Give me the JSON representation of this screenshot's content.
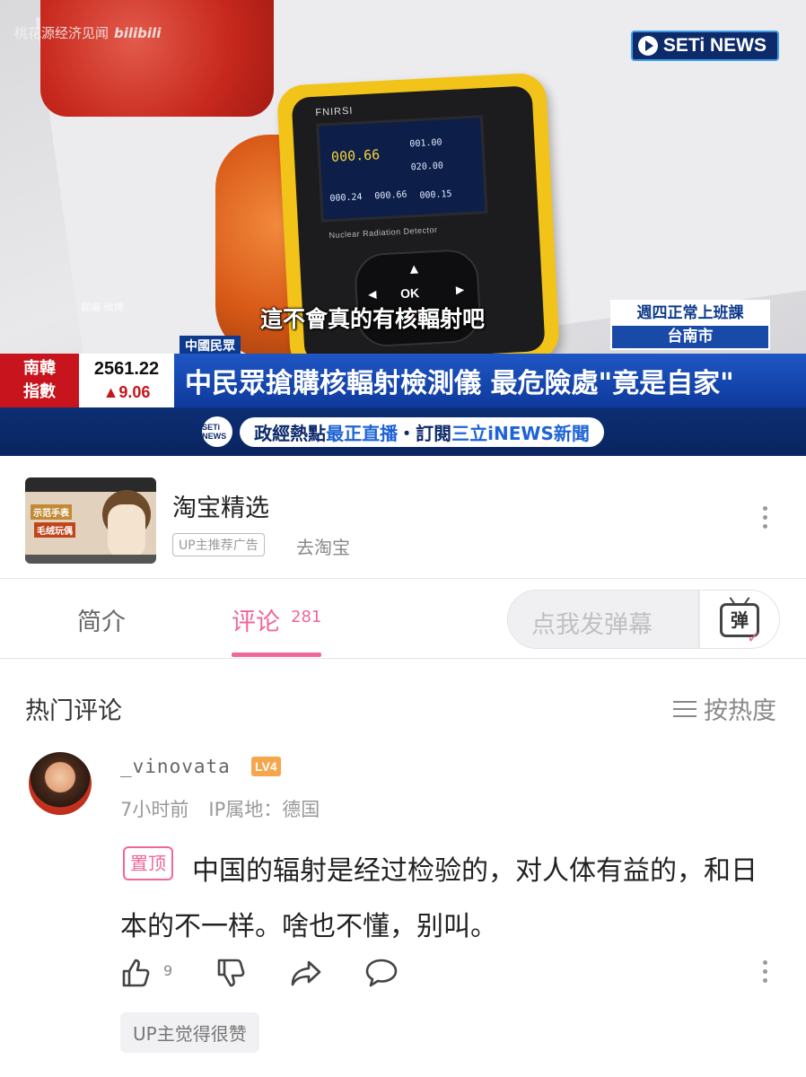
{
  "video": {
    "watermark": "桃花源经济见闻",
    "platform": "bilibili",
    "channel_logo": "SETi NEWS",
    "corner_tag": "翻攝 微博",
    "subtitle": "這不會真的有核輻射吧",
    "location": {
      "line1": "週四正常上班課",
      "line2": "台南市"
    },
    "crawl_tag": "中國民眾",
    "ticker": {
      "market_line1": "南韓",
      "market_line2": "指數",
      "index": "2561.22",
      "change": "▲9.06"
    },
    "headline": "中民眾搶購核輻射檢測儀  最危險處\"竟是自家\"",
    "promo": {
      "logo": "SETi NEWS",
      "part1": "政經熱點",
      "part2": "最正直播",
      "part3": "・訂閱",
      "part4": "三立iNEWS新聞"
    },
    "device": {
      "brand": "FNIRSI",
      "label": "Nuclear Radiation Detector",
      "reading_main": "000.66",
      "reading_2": "001.00",
      "reading_3": "020.00",
      "reading_4": "000.24",
      "reading_5": "000.66",
      "reading_6": "000.15",
      "ok": "OK"
    }
  },
  "ad": {
    "title": "淘宝精选",
    "badge": "UP主推荐广告",
    "link": "去淘宝",
    "thumb_text1": "示范手表",
    "thumb_text2": "毛绒玩偶"
  },
  "tabs": {
    "intro": "简介",
    "comments": "评论",
    "comment_count": "281",
    "danmaku_placeholder": "点我发弹幕",
    "danmaku_icon": "弹"
  },
  "comments_section": {
    "header": "热门评论",
    "sort_label": "按热度"
  },
  "comment": {
    "username": "_vinovata",
    "level": "LV4",
    "time": "7小时前",
    "ip": "IP属地：德国",
    "pinned_label": "置顶",
    "text": "中国的辐射是经过检验的，对人体有益的，和日本的不一样。啥也不懂，别叫。",
    "likes": "9",
    "up_liked": "UP主觉得很赞"
  },
  "colors": {
    "accent_pink": "#f0679a",
    "news_blue": "#0e3a9c",
    "news_red": "#c8141d"
  }
}
